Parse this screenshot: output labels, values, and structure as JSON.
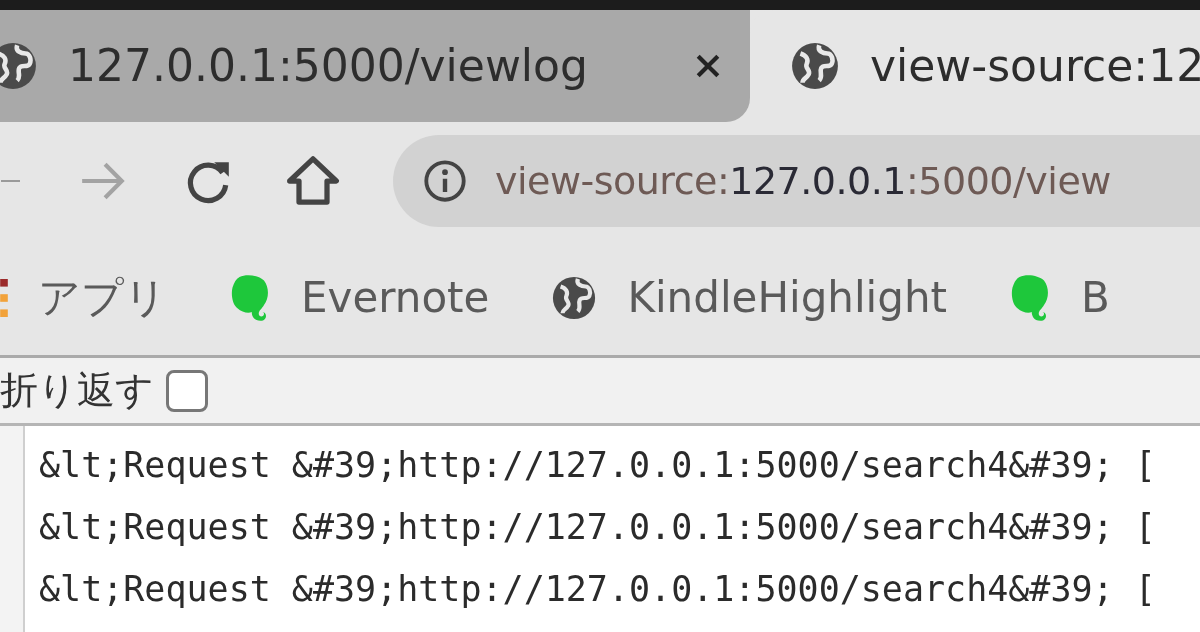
{
  "tabs": [
    {
      "title": "127.0.0.1:5000/viewlog",
      "selected": false
    },
    {
      "title": "view-source:12",
      "selected": true
    }
  ],
  "toolbar": {
    "forward_disabled": true,
    "address": {
      "scheme": "view-source:",
      "host": "127.0.0.1",
      "rest": ":5000/view"
    }
  },
  "bookmarks": [
    {
      "kind": "apps",
      "label": "アプリ"
    },
    {
      "kind": "evernote",
      "label": "Evernote"
    },
    {
      "kind": "globe",
      "label": "KindleHighlight"
    },
    {
      "kind": "evernote",
      "label": "B"
    }
  ],
  "wrap_option": {
    "label": "折り返す",
    "checked": false
  },
  "source_lines": [
    "&lt;Request &#39;http://127.0.0.1:5000/search4&#39; [",
    "&lt;Request &#39;http://127.0.0.1:5000/search4&#39; [",
    "&lt;Request &#39;http://127.0.0.1:5000/search4&#39; ["
  ]
}
